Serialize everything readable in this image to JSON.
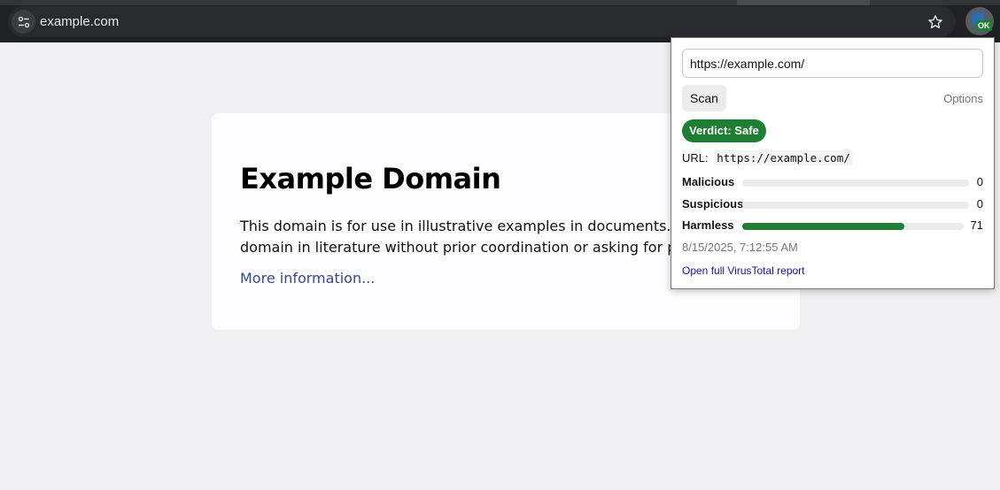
{
  "browser": {
    "address": "example.com",
    "extension_badge": "OK"
  },
  "page": {
    "title": "Example Domain",
    "paragraph_line1": "This domain is for use in illustrative examples in documents. You may use this",
    "paragraph_line2": "domain in literature without prior coordination or asking for permission.",
    "link": "More information..."
  },
  "popup": {
    "url_value": "https://example.com/",
    "scan_label": "Scan",
    "options_label": "Options",
    "verdict": "Verdict: Safe",
    "url_label": "URL:",
    "url_code": "https://example.com/",
    "stats": [
      {
        "label": "Malicious",
        "count": "0",
        "fraction": 0.0
      },
      {
        "label": "Suspicious",
        "count": "0",
        "fraction": 0.0
      },
      {
        "label": "Harmless",
        "count": "71",
        "fraction": 0.73
      }
    ],
    "timestamp": "8/15/2025, 7:12:55 AM",
    "report_link": "Open full VirusTotal report"
  },
  "colors": {
    "safe_green": "#1e7e34",
    "link_blue": "#1a0dab"
  }
}
